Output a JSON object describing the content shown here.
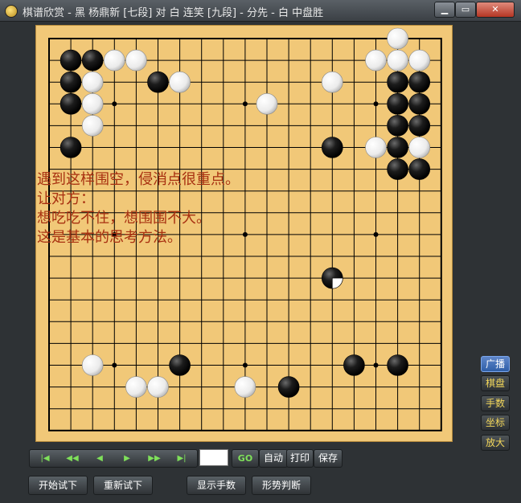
{
  "window": {
    "title": "棋谱欣赏 - 黑 杨鼎新 [七段] 对 白 连笑 [九段] - 分先 - 白 中盘胜",
    "controls": [
      "▁",
      "▭",
      "✕"
    ]
  },
  "board": {
    "size": 19,
    "star_points": [
      [
        3,
        3
      ],
      [
        9,
        3
      ],
      [
        15,
        3
      ],
      [
        3,
        9
      ],
      [
        9,
        9
      ],
      [
        15,
        9
      ],
      [
        3,
        15
      ],
      [
        9,
        15
      ],
      [
        15,
        15
      ]
    ],
    "black_stones": [
      [
        1,
        1
      ],
      [
        2,
        1
      ],
      [
        1,
        2
      ],
      [
        5,
        2
      ],
      [
        1,
        3
      ],
      [
        1,
        5
      ],
      [
        13,
        5
      ],
      [
        16,
        2
      ],
      [
        16,
        3
      ],
      [
        16,
        4
      ],
      [
        17,
        2
      ],
      [
        17,
        3
      ],
      [
        17,
        4
      ],
      [
        16,
        5
      ],
      [
        16,
        6
      ],
      [
        17,
        6
      ],
      [
        6,
        15
      ],
      [
        14,
        15
      ],
      [
        16,
        15
      ],
      [
        11,
        16
      ]
    ],
    "white_stones": [
      [
        3,
        1
      ],
      [
        4,
        1
      ],
      [
        2,
        2
      ],
      [
        6,
        2
      ],
      [
        2,
        3
      ],
      [
        2,
        4
      ],
      [
        10,
        3
      ],
      [
        13,
        2
      ],
      [
        16,
        0
      ],
      [
        16,
        1
      ],
      [
        16,
        2
      ],
      [
        15,
        1
      ],
      [
        17,
        1
      ],
      [
        16,
        3
      ],
      [
        15,
        5
      ],
      [
        16,
        4
      ],
      [
        17,
        5
      ],
      [
        2,
        15
      ],
      [
        4,
        16
      ],
      [
        5,
        16
      ],
      [
        9,
        16
      ]
    ],
    "last_move": {
      "color": "black",
      "point": [
        13,
        11
      ]
    }
  },
  "comment": {
    "lines": [
      "遇到这样围空，侵消点很重点。",
      "让对方：",
      "想吃吃不住，想围围不大。",
      "这是基本的思考方法。"
    ]
  },
  "side_tabs": [
    "广播",
    "棋盘",
    "手数",
    "坐标",
    "放大"
  ],
  "nav": {
    "first": "|◀",
    "prev10": "◀◀",
    "prev": "◀",
    "next": "▶",
    "next10": "▶▶",
    "last": "▶|",
    "move_number": "",
    "go": "GO",
    "auto": "自动",
    "print": "打印",
    "save": "保存"
  },
  "bottom": {
    "start_trial": "开始试下",
    "restart_trial": "重新试下",
    "show_moves": "显示手数",
    "judge": "形势判断"
  }
}
